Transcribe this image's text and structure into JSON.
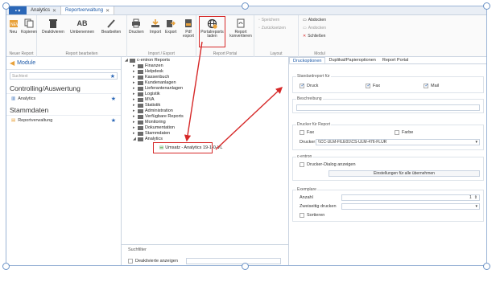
{
  "tabs": {
    "app_button": "▪ ▾",
    "items": [
      {
        "label": "Analytics"
      },
      {
        "label": "Reportverwaltung"
      }
    ]
  },
  "ribbon": {
    "neuer_report": {
      "label": "Neuer Report",
      "buttons": [
        "Neu",
        "Kopieren"
      ]
    },
    "report_bearbeiten": {
      "label": "Report bearbeiten",
      "buttons": [
        "Deaktivieren",
        "Umbenennen",
        "Bearbeiten"
      ]
    },
    "import_export": {
      "label": "Import / Export",
      "buttons": [
        "Drucken",
        "Import",
        "Export",
        "Pdf export"
      ]
    },
    "report_portal": {
      "label": "Report Portal",
      "buttons": [
        "Portalreports laden",
        "Report konvertieren"
      ]
    },
    "layout": {
      "label": "Layout",
      "buttons": [
        "Speichern",
        "Zurücksetzen"
      ]
    },
    "modul": {
      "label": "Modul",
      "buttons": [
        "Abdocken",
        "Andocken",
        "Schließen"
      ]
    }
  },
  "sidebar": {
    "title": "Module",
    "search_placeholder": "Suchtext",
    "sections": [
      {
        "title": "Controlling/Auswertung",
        "items": [
          "Analytics"
        ]
      },
      {
        "title": "Stammdaten",
        "items": [
          "Reportverwaltung"
        ]
      }
    ]
  },
  "tree": {
    "root": "c-entron Reports",
    "children": [
      "Finanzen",
      "Helpdesk",
      "Kassenbuch",
      "Kundenanlagen",
      "Lieferantenanlagen",
      "Logistik",
      "MVA",
      "Statistik",
      "Administration",
      "Verfügbare Reports",
      "Monitoring",
      "Dokumentation",
      "Stammdaten",
      "Analytics"
    ],
    "selected_child": "Umsatz - Analytics 19-1-0-VL"
  },
  "filter": {
    "title": "Suchfilter",
    "checkbox_label": "Deaktivierte anzeigen"
  },
  "props": {
    "tabs": [
      "Druckoptionen",
      "Duplikat/Papieroptionen",
      "Report Portal"
    ],
    "standardreport": {
      "title": "Standardreport für",
      "options": [
        {
          "label": "Druck",
          "checked": true
        },
        {
          "label": "Fax",
          "checked": true
        },
        {
          "label": "Mail",
          "checked": true
        }
      ]
    },
    "beschreibung": {
      "title": "Beschreibung"
    },
    "drucker": {
      "title": "Drucker für Report",
      "fax_label": "Fax",
      "farbe_label": "Farbe",
      "drucker_label": "Drucker:",
      "drucker_value": "\\\\CC-ULM-FILE01\\CS-ULM-476-FLUR"
    },
    "centron": {
      "title": "c-entron",
      "dialog_label": "Drucker-Dialog anzeigen",
      "apply_button": "Einstellungen für alle übernehmen"
    },
    "exemplare": {
      "title": "Exemplare",
      "anzahl_label": "Anzahl",
      "anzahl_value": "1",
      "zweiseitig_label": "Zweiseitig drucken",
      "sortieren_label": "Sortieren"
    }
  }
}
